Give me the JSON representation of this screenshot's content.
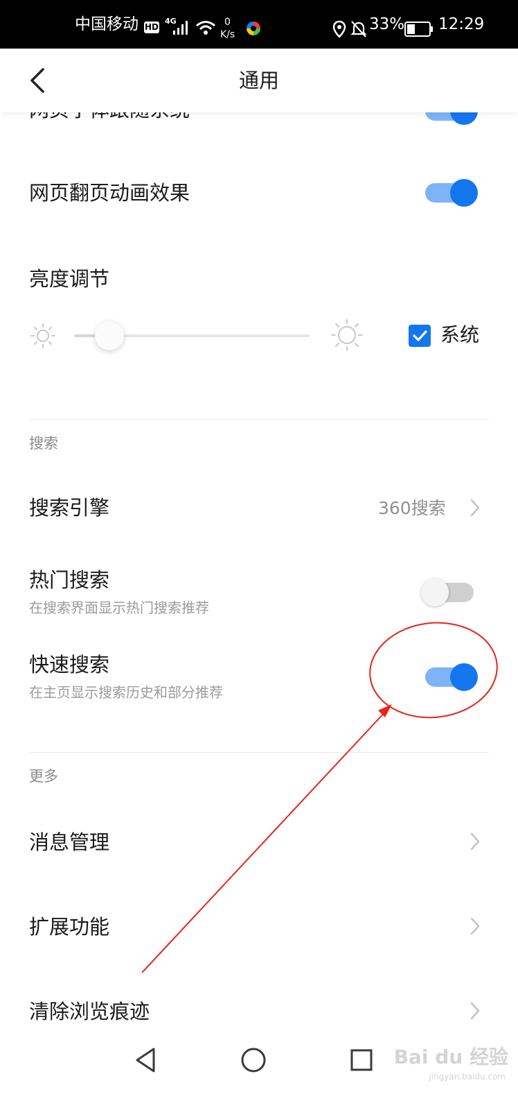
{
  "status_bar": {
    "carrier": "中国移动",
    "hd_badge": "HD",
    "network_type": "4G",
    "speed_value": "0",
    "speed_unit": "K/s",
    "battery": "33%",
    "time": "12:29",
    "icons": [
      "hd-icon",
      "signal-icon",
      "wifi-icon",
      "app-icon",
      "location-icon",
      "mute-bell-icon",
      "battery-icon"
    ]
  },
  "header": {
    "title": "通用",
    "back_icon": "chevron-left-icon"
  },
  "general": {
    "font_follow_system": {
      "label": "网页字体跟随系统",
      "enabled": true
    },
    "page_flip_animation": {
      "label": "网页翻页动画效果",
      "enabled": true
    },
    "brightness": {
      "label": "亮度调节",
      "level": 0.15,
      "system_label": "系统",
      "system_checked": true,
      "icons": [
        "brightness-low-icon",
        "brightness-high-icon",
        "checkmark-icon"
      ]
    }
  },
  "search_section": {
    "title": "搜索",
    "engine": {
      "label": "搜索引擎",
      "value": "360搜索"
    },
    "hot_search": {
      "label": "热门搜索",
      "description": "在搜索界面显示热门搜索推荐",
      "enabled": false
    },
    "quick_search": {
      "label": "快速搜索",
      "description": "在主页显示搜索历史和部分推荐",
      "enabled": true
    }
  },
  "more_section": {
    "title": "更多",
    "items": [
      {
        "label": "消息管理"
      },
      {
        "label": "扩展功能"
      },
      {
        "label": "清除浏览痕迹"
      }
    ]
  },
  "nav_bar": {
    "icons": [
      "back-triangle-icon",
      "home-circle-icon",
      "recents-square-icon"
    ]
  },
  "watermark": {
    "text": "Bai du 经验",
    "sub": "jingyan.baidu.com"
  },
  "colors": {
    "accent": "#1476ee",
    "toggle_track_on": "#7db4f7",
    "annotation_red": "#e8231a"
  }
}
